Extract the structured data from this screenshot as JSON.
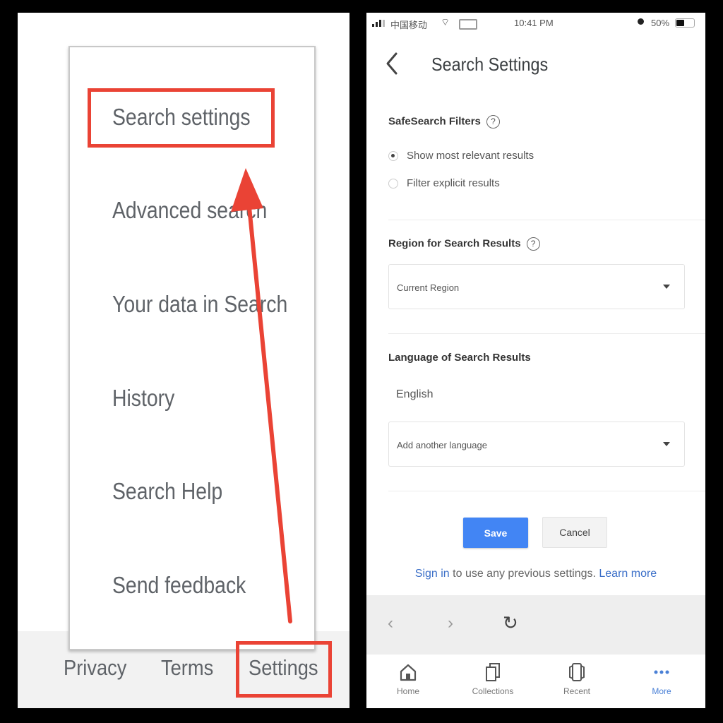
{
  "left": {
    "menu_items": [
      "Search settings",
      "Advanced search",
      "Your data in Search",
      "History",
      "Search Help",
      "Send feedback"
    ],
    "footer_links": {
      "privacy": "Privacy",
      "terms": "Terms",
      "settings": "Settings"
    },
    "annotation_color": "#ea4335"
  },
  "right": {
    "status_bar": {
      "carrier": "中国移动",
      "time": "10:41 PM",
      "battery": "50%",
      "battery_level": 0.5
    },
    "header": {
      "title": "Search Settings"
    },
    "safesearch": {
      "title": "SafeSearch Filters",
      "options": [
        {
          "label": "Show most relevant results",
          "checked": true
        },
        {
          "label": "Filter explicit results",
          "checked": false
        }
      ]
    },
    "region": {
      "title": "Region for Search Results",
      "selected": "Current Region"
    },
    "language": {
      "title": "Language of Search Results",
      "current": "English",
      "add_placeholder": "Add another language"
    },
    "buttons": {
      "save": "Save",
      "cancel": "Cancel"
    },
    "signin": {
      "link": "Sign in",
      "text": " to use any previous settings. ",
      "learn_more": "Learn more"
    },
    "browser_bar": {
      "back": "‹",
      "forward": "›",
      "reload": "↻"
    },
    "tabs": [
      {
        "label": "Home",
        "icon": "home-icon",
        "active": false
      },
      {
        "label": "Collections",
        "icon": "collections-icon",
        "active": false
      },
      {
        "label": "Recent",
        "icon": "recent-icon",
        "active": false
      },
      {
        "label": "More",
        "icon": "more-icon",
        "active": true
      }
    ],
    "colors": {
      "primary": "#4285f4",
      "link": "#3b6fc8"
    }
  }
}
